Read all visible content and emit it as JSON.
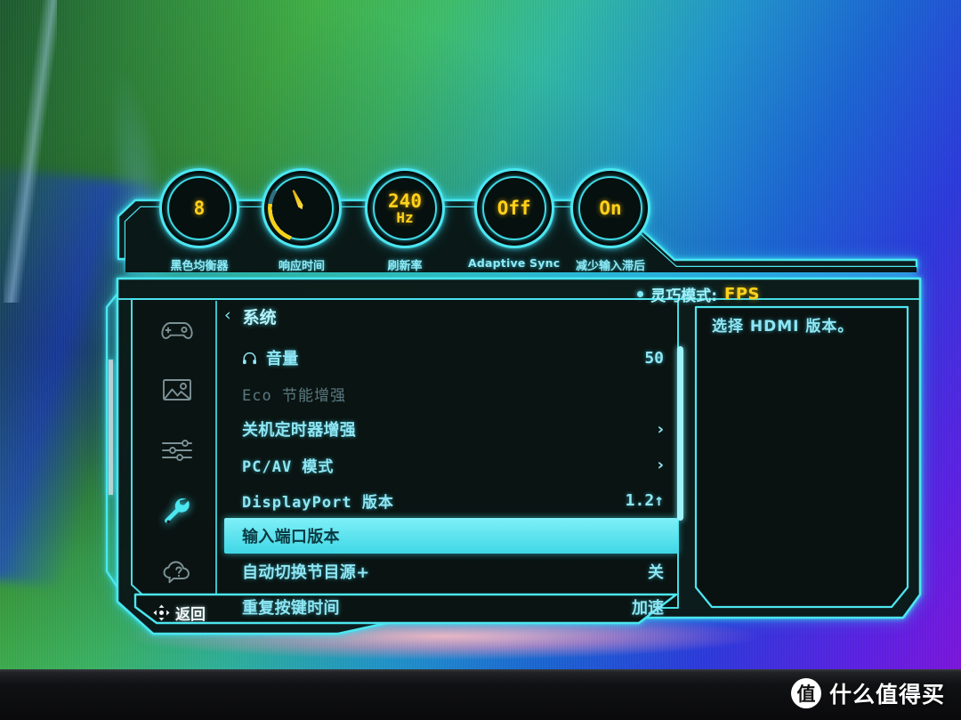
{
  "header": {
    "dials": [
      {
        "name": "black-equalizer",
        "value": "8",
        "sub": "",
        "label": "黑色均衡器",
        "lang": "cn",
        "type": "value"
      },
      {
        "name": "response-time",
        "value": "",
        "sub": "",
        "label": "响应时间",
        "lang": "cn",
        "type": "gauge"
      },
      {
        "name": "refresh-rate",
        "value": "240",
        "sub": "Hz",
        "label": "刷新率",
        "lang": "cn",
        "type": "value"
      },
      {
        "name": "adaptive-sync",
        "value": "Off",
        "sub": "",
        "label": "Adaptive Sync",
        "lang": "en",
        "type": "value"
      },
      {
        "name": "low-input-lag",
        "value": "On",
        "sub": "",
        "label": "减少输入滞后",
        "lang": "cn",
        "type": "value"
      }
    ]
  },
  "status": {
    "mode_label": "灵巧模式:",
    "mode_value": "FPS"
  },
  "sidebar": {
    "items": [
      {
        "icon": "gamepad-icon",
        "label": "游戏",
        "active": false
      },
      {
        "icon": "picture-icon",
        "label": "图像",
        "active": false
      },
      {
        "icon": "sliders-icon",
        "label": "调节",
        "active": false
      },
      {
        "icon": "wrench-icon",
        "label": "系统",
        "active": true
      },
      {
        "icon": "help-cloud-icon",
        "label": "帮助",
        "active": false
      }
    ]
  },
  "menu": {
    "breadcrumb_arrow": "‹",
    "title": "系统",
    "rows": [
      {
        "label": "音量",
        "value": "50",
        "icon": "headphone-icon",
        "chevron": false,
        "disabled": false,
        "selected": false,
        "mono": false,
        "value_cn": false
      },
      {
        "label": "Eco  节能增强",
        "value": "",
        "icon": "",
        "chevron": false,
        "disabled": true,
        "selected": false,
        "mono": true,
        "value_cn": false
      },
      {
        "label": "关机定时器增强",
        "value": "",
        "icon": "",
        "chevron": true,
        "disabled": false,
        "selected": false,
        "mono": false,
        "value_cn": false
      },
      {
        "label": "PC/AV 模式",
        "value": "",
        "icon": "",
        "chevron": true,
        "disabled": false,
        "selected": false,
        "mono": true,
        "value_cn": false
      },
      {
        "label": "DisplayPort 版本",
        "value": "1.2↑",
        "icon": "",
        "chevron": false,
        "disabled": false,
        "selected": false,
        "mono": true,
        "value_cn": false
      },
      {
        "label": "输入端口版本",
        "value": "",
        "icon": "",
        "chevron": false,
        "disabled": false,
        "selected": true,
        "mono": false,
        "value_cn": false
      },
      {
        "label": "自动切换节目源+",
        "value": "关",
        "icon": "",
        "chevron": false,
        "disabled": false,
        "selected": false,
        "mono": false,
        "value_cn": true
      },
      {
        "label": "重复按键时间",
        "value": "加速",
        "icon": "",
        "chevron": false,
        "disabled": false,
        "selected": false,
        "mono": false,
        "value_cn": true
      }
    ]
  },
  "info_panel": {
    "text": "选择 HDMI 版本。"
  },
  "footer": {
    "back_label": "返回",
    "back_icon": "dpad-icon"
  },
  "watermark": {
    "logo_char": "值",
    "text": "什么值得买"
  },
  "colors": {
    "accent_cyan": "#4ce6f0",
    "value_yellow": "#ffd21a",
    "panel_dark": "#0a1412",
    "disabled_gray": "#5a7a80"
  }
}
